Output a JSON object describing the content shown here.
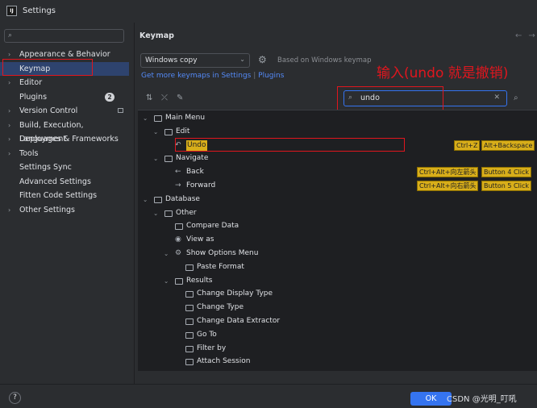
{
  "window": {
    "title": "Settings",
    "app_icon_text": "IJ"
  },
  "sidebar": {
    "search_placeholder": "",
    "items": [
      {
        "label": "Appearance & Behavior",
        "expandable": true
      },
      {
        "label": "Keymap",
        "expandable": false,
        "selected": true
      },
      {
        "label": "Editor",
        "expandable": true
      },
      {
        "label": "Plugins",
        "expandable": false,
        "badge": "2"
      },
      {
        "label": "Version Control",
        "expandable": true
      },
      {
        "label": "Build, Execution, Deployment",
        "expandable": true
      },
      {
        "label": "Languages & Frameworks",
        "expandable": true
      },
      {
        "label": "Tools",
        "expandable": true
      },
      {
        "label": "Settings Sync",
        "expandable": false
      },
      {
        "label": "Advanced Settings",
        "expandable": false
      },
      {
        "label": "Fitten Code Settings",
        "expandable": false
      },
      {
        "label": "Other Settings",
        "expandable": true
      }
    ]
  },
  "main": {
    "title": "Keymap",
    "keymap_select": "Windows copy",
    "based_on": "Based on Windows keymap",
    "get_more_link": "Get more keymaps in Settings",
    "link_separator": "|",
    "plugins_link": "Plugins",
    "filter_value": "undo",
    "annotation": "输入(undo 就是撤销)"
  },
  "tree": [
    {
      "label": "Main Menu",
      "level": 0,
      "kind": "folder",
      "expanded": true
    },
    {
      "label": "Edit",
      "level": 1,
      "kind": "folder",
      "expanded": true
    },
    {
      "label": "Undo",
      "level": 2,
      "kind": "action",
      "icon": "undo-icon",
      "match": true,
      "shortcuts": [
        "Ctrl+Z",
        "Alt+Backspace"
      ]
    },
    {
      "label": "Navigate",
      "level": 1,
      "kind": "folder",
      "expanded": true
    },
    {
      "label": "Back",
      "level": 2,
      "kind": "action",
      "icon": "arrow-left-icon",
      "shortcuts": [
        "Ctrl+Alt+向左箭头",
        "Button 4 Click"
      ]
    },
    {
      "label": "Forward",
      "level": 2,
      "kind": "action",
      "icon": "arrow-right-icon",
      "shortcuts": [
        "Ctrl+Alt+向右箭头",
        "Button 5 Click"
      ]
    },
    {
      "label": "Database",
      "level": 0,
      "kind": "folder",
      "expanded": true
    },
    {
      "label": "Other",
      "level": 1,
      "kind": "folder",
      "expanded": true
    },
    {
      "label": "Compare Data",
      "level": 2,
      "kind": "folder"
    },
    {
      "label": "View as",
      "level": 2,
      "kind": "action",
      "icon": "eye-icon"
    },
    {
      "label": "Show Options Menu",
      "level": 2,
      "kind": "gear",
      "expanded": true
    },
    {
      "label": "Paste Format",
      "level": 3,
      "kind": "folder"
    },
    {
      "label": "Results",
      "level": 2,
      "kind": "folder",
      "expanded": true
    },
    {
      "label": "Change Display Type",
      "level": 3,
      "kind": "folder"
    },
    {
      "label": "Change Type",
      "level": 3,
      "kind": "folder"
    },
    {
      "label": "Change Data Extractor",
      "level": 3,
      "kind": "folder"
    },
    {
      "label": "Go To",
      "level": 3,
      "kind": "folder"
    },
    {
      "label": "Filter by",
      "level": 3,
      "kind": "folder"
    },
    {
      "label": "Attach Session",
      "level": 3,
      "kind": "folder"
    }
  ],
  "footer": {
    "help_label": "?",
    "ok_label": "OK",
    "watermark": "CSDN @光明_叮吼"
  },
  "colors": {
    "accent": "#3574f0",
    "selection": "#2e436e",
    "match_highlight": "#d8ae1a",
    "annotation_red": "#e0161e"
  }
}
